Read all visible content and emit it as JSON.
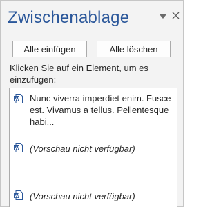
{
  "pane": {
    "title": "Zwischenablage",
    "menu_icon": "chevron-down-icon",
    "close_icon": "close-icon"
  },
  "toolbar": {
    "paste_all_label": "Alle einfügen",
    "clear_all_label": "Alle löschen"
  },
  "instruction": "Klicken Sie auf ein Element, um es einzufügen:",
  "items": [
    {
      "icon": "word-document-icon",
      "text": "Nunc viverra imperdiet enim. Fusce est. Vivamus a tellus. Pellentesque habi..."
    },
    {
      "icon": "word-document-icon",
      "text": "(Vorschau nicht verfügbar)"
    },
    {
      "icon": "word-document-icon",
      "text": "(Vorschau nicht verfügbar)"
    }
  ],
  "colors": {
    "title": "#2b579a",
    "icon_blue": "#2b579a",
    "pane_background": "#f3f3f3"
  }
}
